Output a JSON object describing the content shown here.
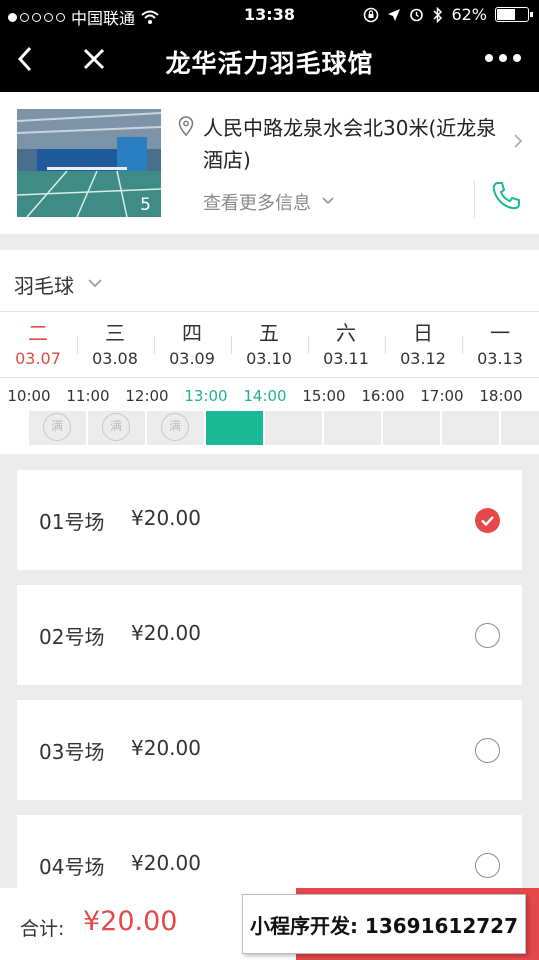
{
  "status_bar": {
    "carrier": "中国联通",
    "time": "13:38",
    "battery_percent": "62%",
    "battery_level": 0.62
  },
  "nav": {
    "title": "龙华活力羽毛球馆"
  },
  "venue": {
    "photo_count": "5",
    "address": "人民中路龙泉水会北30米(近龙泉酒店)",
    "more_info": "查看更多信息"
  },
  "sport": {
    "selected": "羽毛球"
  },
  "dates": [
    {
      "weekday": "二",
      "date": "03.07",
      "active": true
    },
    {
      "weekday": "三",
      "date": "03.08",
      "active": false
    },
    {
      "weekday": "四",
      "date": "03.09",
      "active": false
    },
    {
      "weekday": "五",
      "date": "03.10",
      "active": false
    },
    {
      "weekday": "六",
      "date": "03.11",
      "active": false
    },
    {
      "weekday": "日",
      "date": "03.12",
      "active": false
    },
    {
      "weekday": "一",
      "date": "03.13",
      "active": false
    }
  ],
  "times": [
    {
      "label": "10:00",
      "state": "full"
    },
    {
      "label": "11:00",
      "state": "full"
    },
    {
      "label": "12:00",
      "state": "full"
    },
    {
      "label": "13:00",
      "state": "selected"
    },
    {
      "label": "14:00",
      "state": "available"
    },
    {
      "label": "15:00",
      "state": "available"
    },
    {
      "label": "16:00",
      "state": "available"
    },
    {
      "label": "17:00",
      "state": "available"
    },
    {
      "label": "18:00",
      "state": "available"
    }
  ],
  "full_mark": "满",
  "courts": [
    {
      "name": "01号场",
      "price": "¥20.00",
      "checked": true
    },
    {
      "name": "02号场",
      "price": "¥20.00",
      "checked": false
    },
    {
      "name": "03号场",
      "price": "¥20.00",
      "checked": false
    },
    {
      "name": "04号场",
      "price": "¥20.00",
      "checked": false
    }
  ],
  "bottom": {
    "total_label": "合计:",
    "total_value": "¥20.00",
    "promo": "小程序开发: 13691612727"
  },
  "colors": {
    "accent_red": "#e4484a",
    "accent_green": "#1ab893"
  }
}
